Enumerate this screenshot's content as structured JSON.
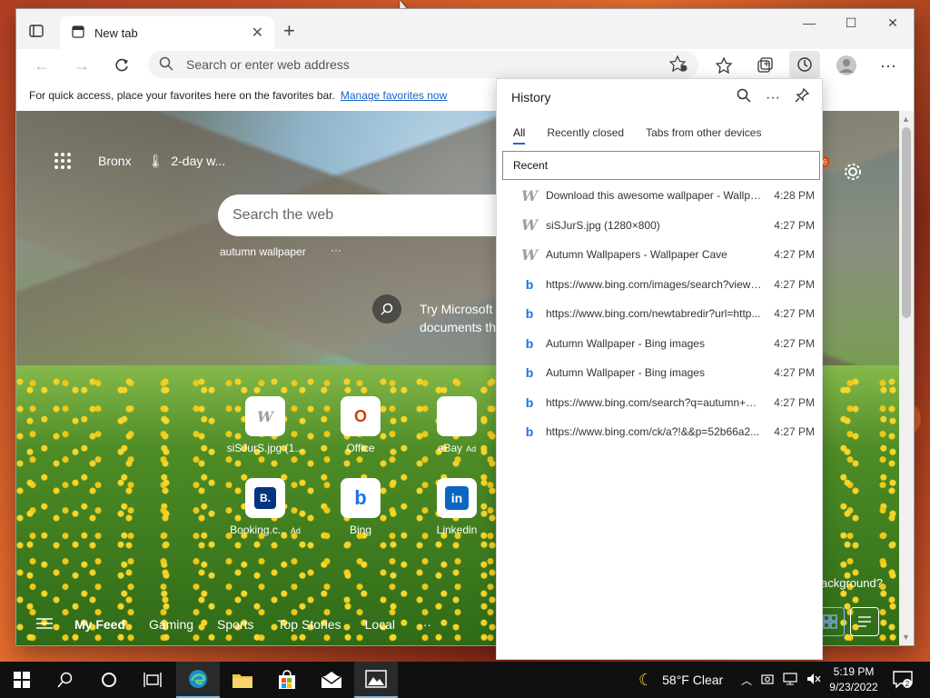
{
  "browser": {
    "tab_title": "New tab",
    "address_placeholder": "Search or enter web address",
    "favbar_text": "For quick access, place your favorites here on the favorites bar.",
    "favbar_link": "Manage favorites now"
  },
  "ntp": {
    "location": "Bronx",
    "weather": "2-day w...",
    "search_placeholder": "Search the web",
    "suggestion": "autumn wallpaper",
    "suggestion_more": "···",
    "promo_line1": "Try Microsoft",
    "promo_line2": "documents th",
    "notification_count": "6",
    "tiles": [
      {
        "label": "siSJurS.jpg (1...",
        "glyph": "W",
        "ad": ""
      },
      {
        "label": "Office",
        "glyph": "O",
        "ad": ""
      },
      {
        "label": "eBay",
        "glyph": "🛍",
        "ad": "Ad"
      },
      {
        "label": "Booking.c...",
        "glyph": "B.",
        "ad": "Ad"
      },
      {
        "label": "Bing",
        "glyph": "b",
        "ad": ""
      },
      {
        "label": "Linkedin",
        "glyph": "in",
        "ad": ""
      }
    ],
    "feed": [
      "My Feed",
      "Gaming",
      "Sports",
      "Top Stories",
      "Local"
    ],
    "feed_more": "···",
    "bg_question": "ackground?"
  },
  "history": {
    "title": "History",
    "tabs": [
      "All",
      "Recently closed",
      "Tabs from other devices"
    ],
    "section": "Recent",
    "items": [
      {
        "title": "Download this awesome wallpaper - Wallpa...",
        "time": "4:28 PM",
        "icon": "wallpapercave-icon"
      },
      {
        "title": "siSJurS.jpg (1280×800)",
        "time": "4:27 PM",
        "icon": "wallpapercave-icon"
      },
      {
        "title": "Autumn Wallpapers - Wallpaper Cave",
        "time": "4:27 PM",
        "icon": "wallpapercave-icon"
      },
      {
        "title": "https://www.bing.com/images/search?view=...",
        "time": "4:27 PM",
        "icon": "bing-icon"
      },
      {
        "title": "https://www.bing.com/newtabredir?url=http...",
        "time": "4:27 PM",
        "icon": "bing-icon"
      },
      {
        "title": "Autumn Wallpaper - Bing images",
        "time": "4:27 PM",
        "icon": "bing-icon"
      },
      {
        "title": "Autumn Wallpaper - Bing images",
        "time": "4:27 PM",
        "icon": "bing-icon"
      },
      {
        "title": "https://www.bing.com/search?q=autumn+w...",
        "time": "4:27 PM",
        "icon": "bing-icon"
      },
      {
        "title": "https://www.bing.com/ck/a?!&&p=52b66a2...",
        "time": "4:27 PM",
        "icon": "bing-icon"
      }
    ]
  },
  "taskbar": {
    "weather": "58°F  Clear",
    "time": "5:19 PM",
    "date": "9/23/2022",
    "notifications": "2"
  },
  "colors": {
    "accent": "#2566c9",
    "taskbar": "#101010",
    "bing_blue": "#1a73e8"
  }
}
